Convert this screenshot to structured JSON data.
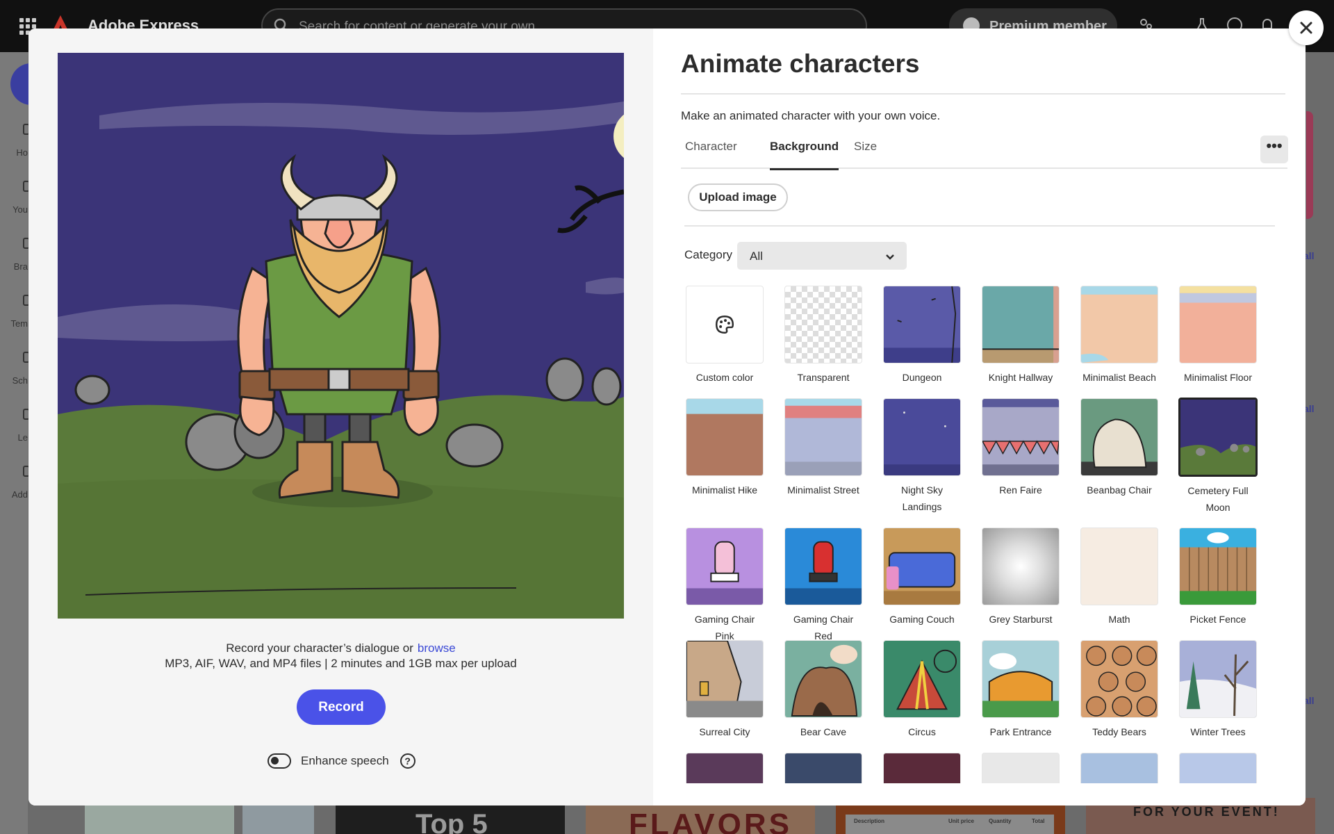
{
  "app": {
    "brand_name": "Adobe Express",
    "search_placeholder": "Search for content or generate your own",
    "premium_label": "Premium member",
    "rail_items": [
      "Ho",
      "You",
      "Bra",
      "Tem",
      "Sch",
      "Le",
      "Add"
    ],
    "right_links": [
      "all",
      "all",
      "all"
    ],
    "bg_thumb_texts": [
      "Top 5",
      "FLAVORS",
      "FOR YOUR EVENT!"
    ],
    "bg_invoice_labels": [
      "Description",
      "Unit price",
      "Quantity",
      "Total"
    ]
  },
  "modal": {
    "title": "Animate characters",
    "subtitle": "Make an animated character with your own voice.",
    "tabs": [
      {
        "label": "Character",
        "active": false
      },
      {
        "label": "Background",
        "active": true
      },
      {
        "label": "Size",
        "active": false
      }
    ],
    "more_label": "•••",
    "upload_label": "Upload image",
    "category": {
      "label": "Category",
      "value": "All"
    },
    "record": {
      "line1": "Record your character’s dialogue or",
      "browse": "browse",
      "line2": "MP3, AIF, WAV, and MP4 files | 2 minutes and 1GB max per upload",
      "button": "Record"
    },
    "enhance": {
      "label": "Enhance speech",
      "enabled": false,
      "help": "?"
    },
    "backgrounds": [
      {
        "label": "Custom color",
        "icon": "palette-icon"
      },
      {
        "label": "Transparent"
      },
      {
        "label": "Dungeon"
      },
      {
        "label": "Knight Hallway"
      },
      {
        "label": "Minimalist Beach"
      },
      {
        "label": "Minimalist Floor"
      },
      {
        "label": "Minimalist Hike"
      },
      {
        "label": "Minimalist Street"
      },
      {
        "label": "Night Sky Landings"
      },
      {
        "label": "Ren Faire"
      },
      {
        "label": "Beanbag Chair"
      },
      {
        "label": "Cemetery Full Moon",
        "selected": true
      },
      {
        "label": "Gaming Chair Pink"
      },
      {
        "label": "Gaming Chair Red"
      },
      {
        "label": "Gaming Couch"
      },
      {
        "label": "Grey Starburst"
      },
      {
        "label": "Math"
      },
      {
        "label": "Picket Fence"
      },
      {
        "label": "Surreal City"
      },
      {
        "label": "Bear Cave"
      },
      {
        "label": "Circus"
      },
      {
        "label": "Park Entrance"
      },
      {
        "label": "Teddy Bears"
      },
      {
        "label": "Winter Trees"
      },
      {
        "label": ""
      },
      {
        "label": ""
      },
      {
        "label": ""
      },
      {
        "label": ""
      },
      {
        "label": ""
      },
      {
        "label": ""
      }
    ]
  },
  "colors": {
    "accent": "#4a52e8",
    "link": "#3b49d6",
    "night_sky": "#3b3478",
    "grass": "#5a7a3a"
  }
}
